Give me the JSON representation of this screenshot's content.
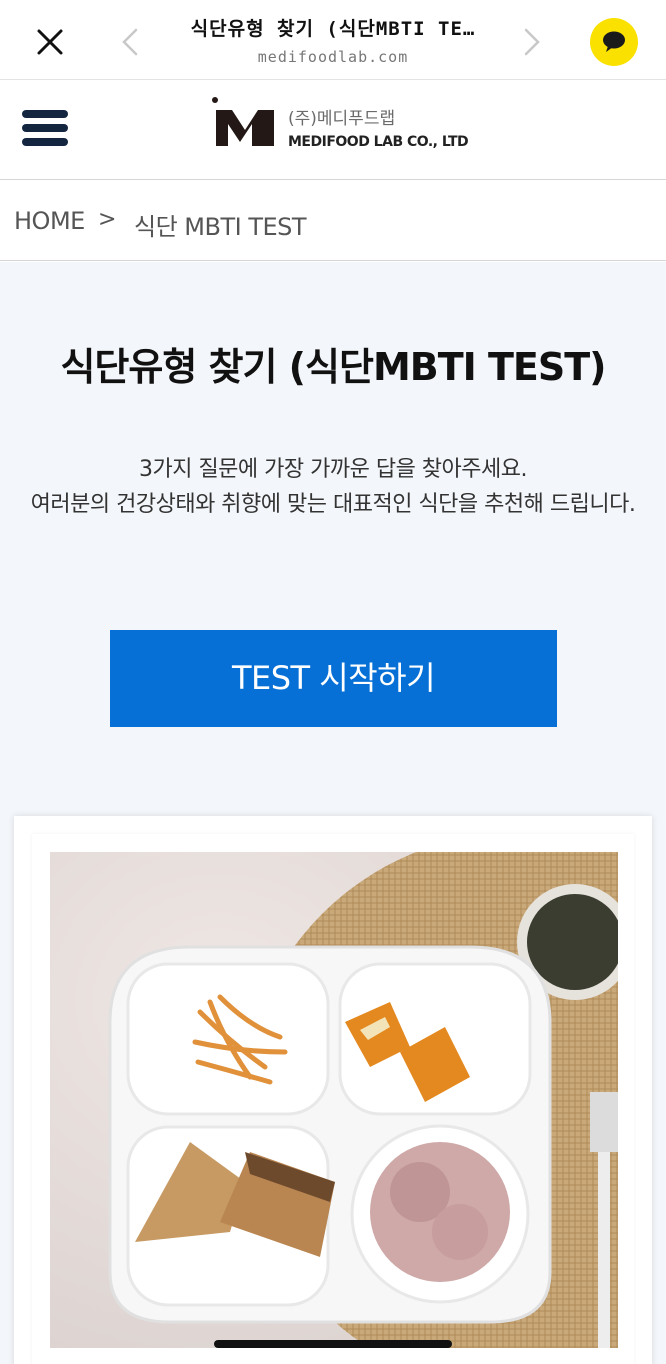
{
  "browser": {
    "title": "식단유형 찾기 (식단MBTI TE…",
    "host": "medifoodlab.com"
  },
  "header": {
    "logo_kr": "(주)메디푸드랩",
    "logo_en": "MEDIFOOD LAB CO., LTD",
    "brand_color": "#231815"
  },
  "breadcrumb": {
    "home": "HOME",
    "separator": ">",
    "current": "식단 MBTI TEST"
  },
  "main": {
    "title": "식단유형 찾기 (식단MBTI TEST)",
    "desc_line1": "3가지 질문에 가장 가까운 답을 찾아주세요.",
    "desc_line2": "여러분의 건강상태와 취향에 맞는 대표적인 식단을 추천해 드립니다.",
    "start_button": "TEST 시작하기",
    "accent_color": "#0670d6"
  },
  "icons": {
    "close": "close-icon",
    "back": "chevron-left-icon",
    "forward": "chevron-right-icon",
    "kakao": "kakao-talk-icon",
    "menu": "hamburger-menu-icon"
  }
}
